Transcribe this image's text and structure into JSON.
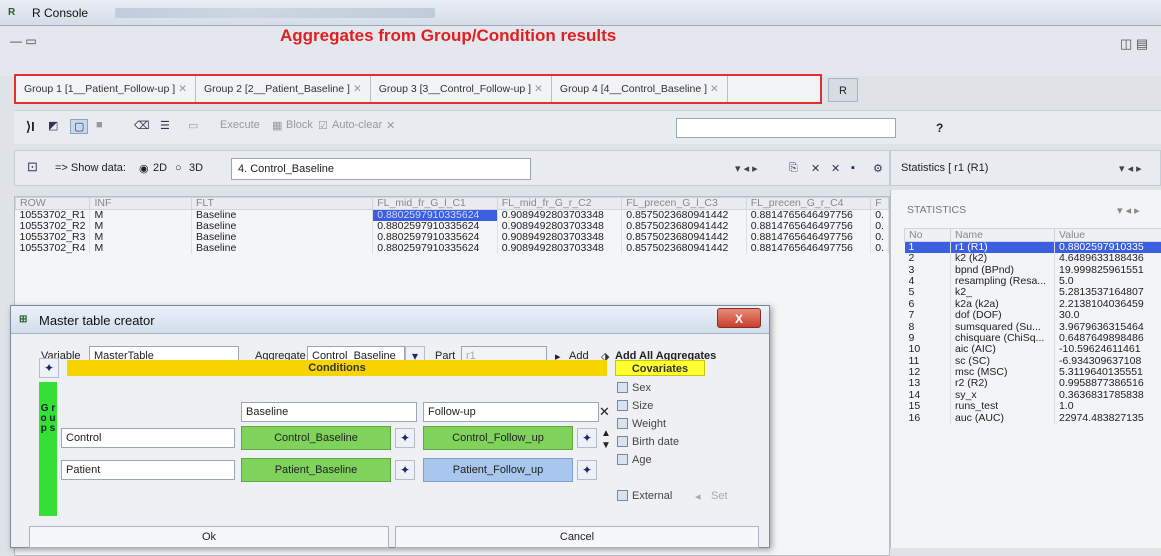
{
  "window": {
    "title": "R Console",
    "app_icon": "R"
  },
  "header": {
    "annotation": "Aggregates from Group/Condition results",
    "window_controls": "— ▭"
  },
  "tabs": [
    {
      "label": "Group 1 [1__Patient_Follow-up ]"
    },
    {
      "label": "Group 2 [2__Patient_Baseline ]"
    },
    {
      "label": "Group 3 [3__Control_Follow-up ]"
    },
    {
      "label": "Group 4 [4__Control_Baseline ]"
    }
  ],
  "tab_r": "R",
  "toolbar": {
    "execute": "Execute",
    "block": "Block",
    "autoclear": "Auto-clear",
    "help": "?"
  },
  "databar": {
    "show_label": "=> Show data:",
    "opt2d": "2D",
    "opt3d": "3D",
    "dataset": "4. Control_Baseline"
  },
  "statsbar": {
    "label": "Statistics [ r1 (R1)"
  },
  "table": {
    "headers": [
      "ROW",
      "INF",
      "FLT",
      "FL_mid_fr_G_l_C1",
      "FL_mid_fr_G_r_C2",
      "FL_precen_G_l_C3",
      "FL_precen_G_r_C4",
      "F"
    ],
    "rows": [
      [
        "10553702_R1",
        "M",
        "Baseline",
        "0.8802597910335624",
        "0.9089492803703348",
        "0.8575023680941442",
        "0.8814765646497756",
        "0."
      ],
      [
        "10553702_R2",
        "M",
        "Baseline",
        "0.8802597910335624",
        "0.9089492803703348",
        "0.8575023680941442",
        "0.8814765646497756",
        "0."
      ],
      [
        "10553702_R3",
        "M",
        "Baseline",
        "0.8802597910335624",
        "0.9089492803703348",
        "0.8575023680941442",
        "0.8814765646497756",
        "0."
      ],
      [
        "10553702_R4",
        "M",
        "Baseline",
        "0.8802597910335624",
        "0.9089492803703348",
        "0.8575023680941442",
        "0.8814765646497756",
        "0."
      ]
    ]
  },
  "stats": {
    "header": "STATISTICS",
    "columns": [
      "No",
      "Name",
      "Value"
    ],
    "rows": [
      [
        "1",
        "r1 (R1)",
        "0.8802597910335"
      ],
      [
        "2",
        "k2 (k2)",
        "4.6489633188436"
      ],
      [
        "3",
        "bpnd (BPnd)",
        "19.999825961551"
      ],
      [
        "4",
        "resampling (Resa...",
        "5.0"
      ],
      [
        "5",
        "k2_",
        "5.2813537164807"
      ],
      [
        "6",
        "k2a (k2a)",
        "2.2138104036459"
      ],
      [
        "7",
        "dof (DOF)",
        "30.0"
      ],
      [
        "8",
        "sumsquared (Su...",
        "3.9679636315464"
      ],
      [
        "9",
        "chisquare (ChiSq...",
        "0.6487649898486"
      ],
      [
        "10",
        "aic (AIC)",
        "-10.59624611461"
      ],
      [
        "11",
        "sc (SC)",
        "-6.934309637108"
      ],
      [
        "12",
        "msc (MSC)",
        "5.3119640135551"
      ],
      [
        "13",
        "r2 (R2)",
        "0.9958877386516"
      ],
      [
        "14",
        "sy_x",
        "0.3636831785838"
      ],
      [
        "15",
        "runs_test",
        "1.0"
      ],
      [
        "16",
        "auc (AUC)",
        "22974.483827135"
      ]
    ]
  },
  "dialog": {
    "title": "Master table creator",
    "close": "X",
    "variable_label": "Variable",
    "variable_value": "MasterTable",
    "aggregate_label": "Aggregate",
    "aggregate_value": "Control_Baseline",
    "part_label": "Part",
    "part_value": "r1",
    "add": "Add",
    "add_all": "Add All Aggregates",
    "conditions_header": "Conditions",
    "covariates_header": "Covariates",
    "groups_label": "G r o u p s",
    "cond1": "Baseline",
    "cond2": "Follow-up",
    "group1": "Control",
    "group2": "Patient",
    "cell11": "Control_Baseline",
    "cell12": "Control_Follow_up",
    "cell21": "Patient_Baseline",
    "cell22": "Patient_Follow_up",
    "covariates": [
      "Sex",
      "Size",
      "Weight",
      "Birth date",
      "Age"
    ],
    "external": "External",
    "set": "Set",
    "ok": "Ok",
    "cancel": "Cancel"
  }
}
